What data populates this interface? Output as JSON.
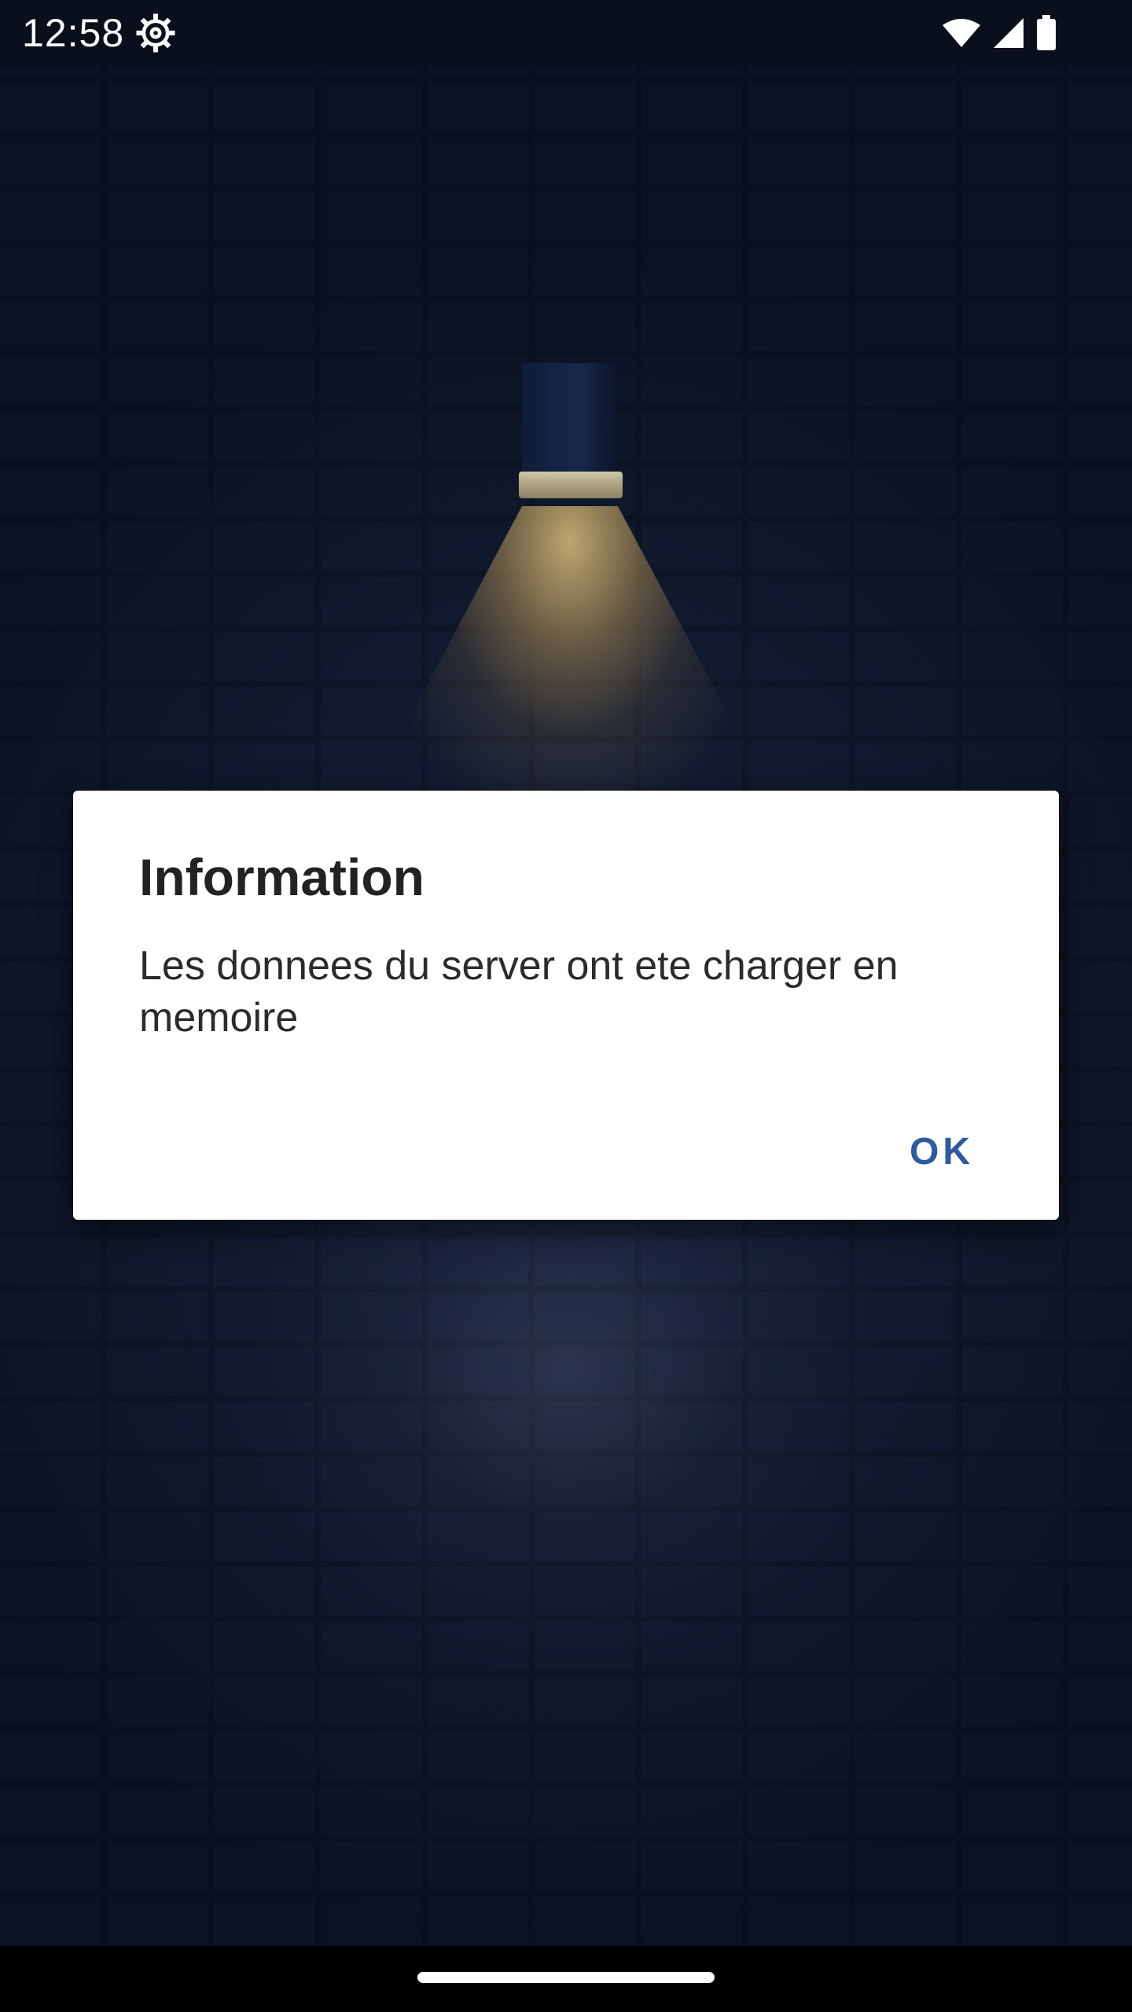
{
  "status_bar": {
    "time": "12:58",
    "icons": [
      "settings-gear-icon",
      "wifi-icon",
      "cellular-signal-icon",
      "battery-icon"
    ]
  },
  "dialog": {
    "title": "Information",
    "message": "Les donnees du server ont ete charger en memoire",
    "ok_label": "OK"
  },
  "colors": {
    "dialog_background": "#ffffff",
    "button_accent": "#2d5aa0",
    "app_background": "#0f1628",
    "lamp_light": "#dcbe78"
  }
}
